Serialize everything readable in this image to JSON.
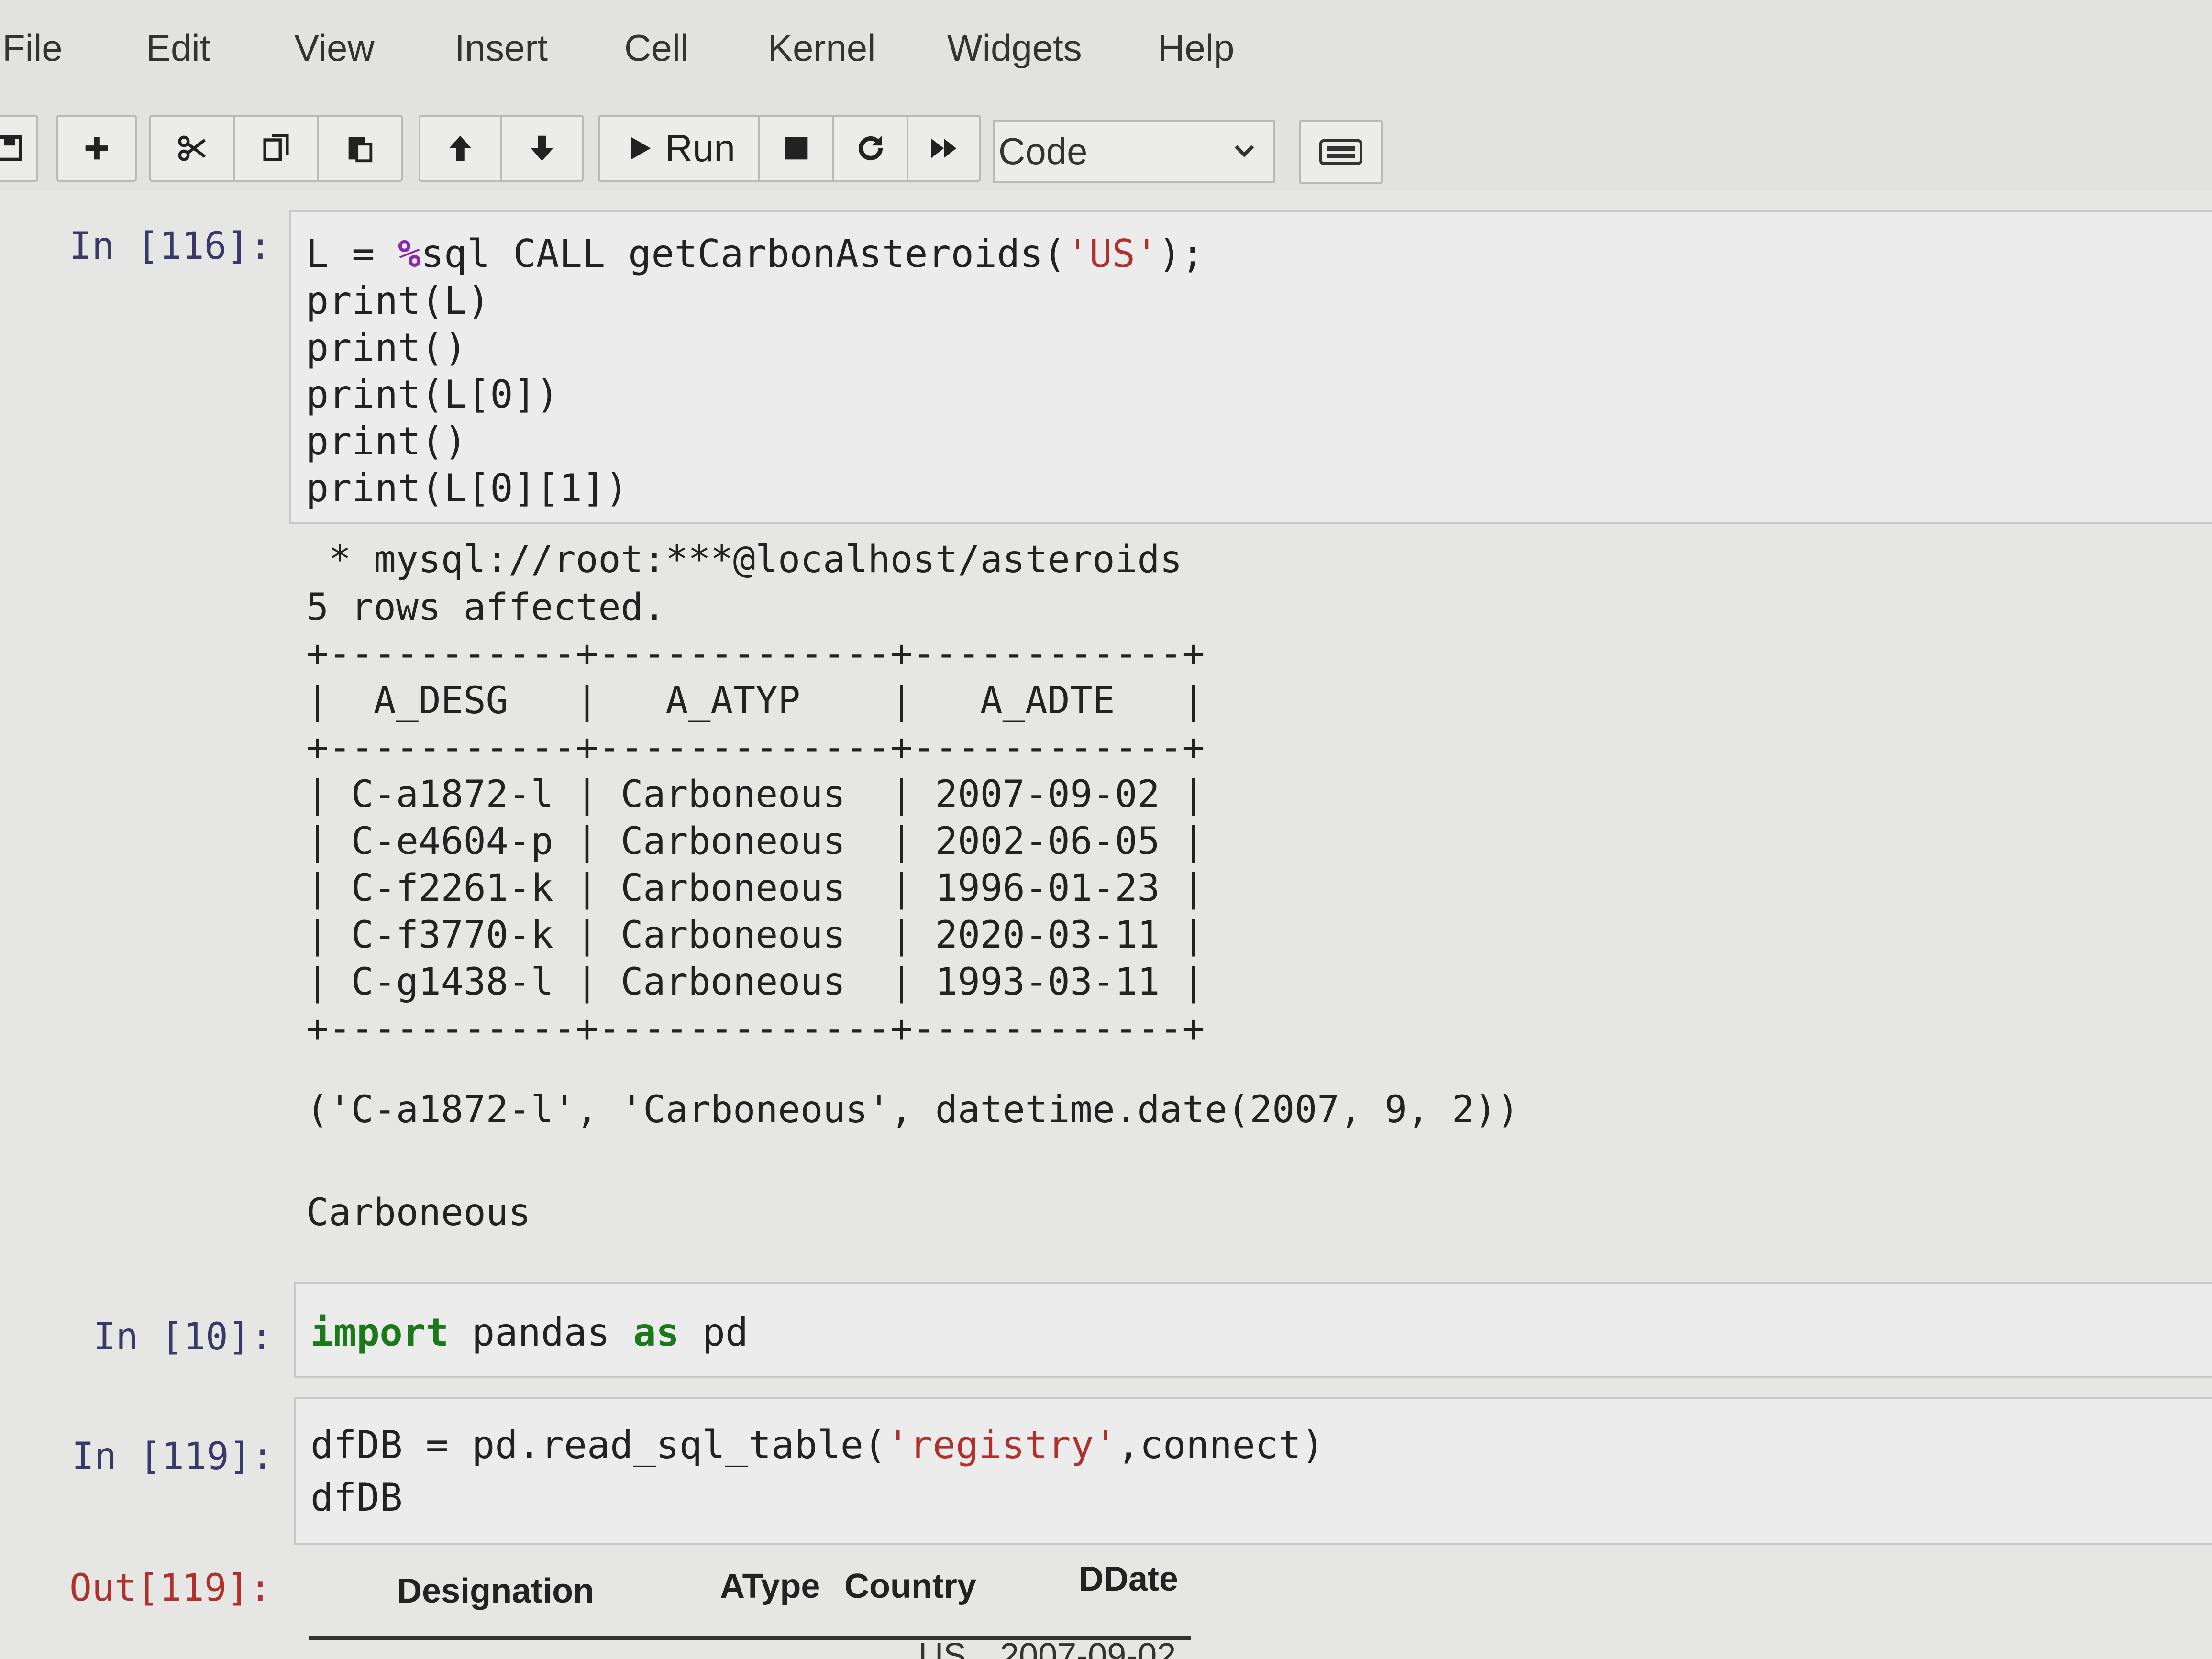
{
  "menu": [
    "File",
    "Edit",
    "View",
    "Insert",
    "Cell",
    "Kernel",
    "Widgets",
    "Help"
  ],
  "toolbar": {
    "run_label": "Run",
    "cell_type": "Code"
  },
  "cells": {
    "c116": {
      "prompt": "In [116]:",
      "code": [
        "L = %sql CALL getCarbonAsteroids('US');",
        "print(L)",
        "print()",
        "print(L[0])",
        "print()",
        "print(L[0][1])"
      ],
      "output": [
        " * mysql://root:***@localhost/asteroids",
        "5 rows affected.",
        "+-----------+-------------+------------+",
        "|  A_DESG   |   A_ATYP    |   A_ADTE   |",
        "+-----------+-------------+------------+",
        "| C-a1872-l | Carboneous  | 2007-09-02 |",
        "| C-e4604-p | Carboneous  | 2002-06-05 |",
        "| C-f2261-k | Carboneous  | 1996-01-23 |",
        "| C-f3770-k | Carboneous  | 2020-03-11 |",
        "| C-g1438-l | Carboneous  | 1993-03-11 |",
        "+-----------+-------------+------------+",
        "('C-a1872-l', 'Carboneous', datetime.date(2007, 9, 2))",
        "Carboneous"
      ]
    },
    "c10": {
      "prompt": "In [10]:",
      "code": [
        "import pandas as pd"
      ]
    },
    "c119": {
      "prompt": "In [119]:",
      "code": [
        "dfDB = pd.read_sql_table('registry',connect)",
        "dfDB"
      ],
      "out_prompt": "Out[119]:",
      "columns": [
        "Designation",
        "AType",
        "Country",
        "DDate"
      ],
      "partial_row": [
        "US",
        "2007-09-02"
      ]
    }
  }
}
